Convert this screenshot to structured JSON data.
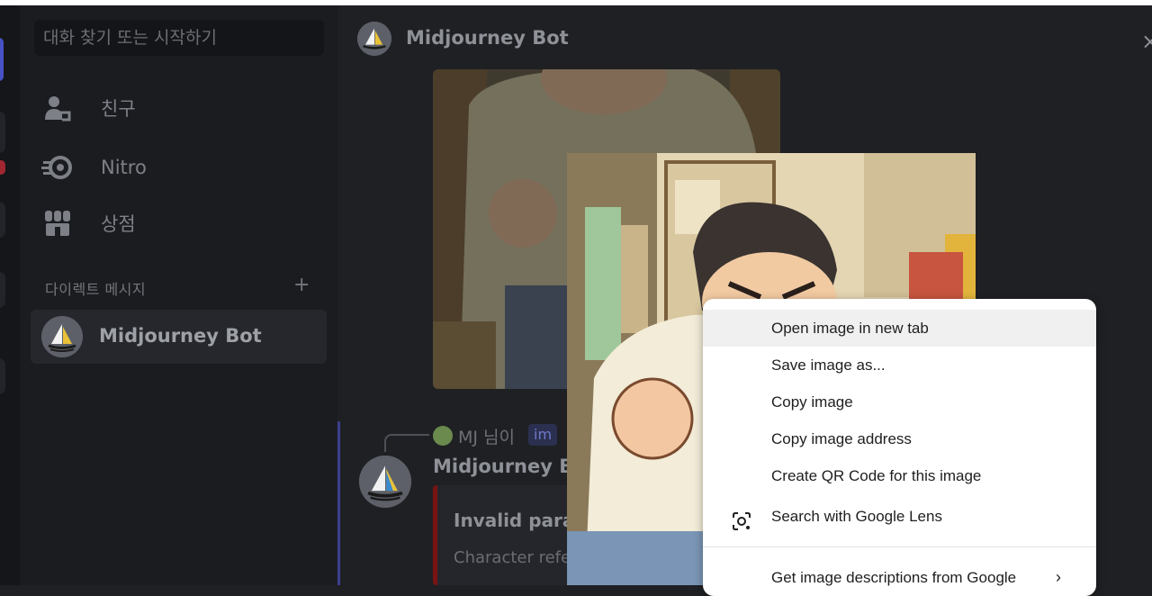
{
  "sidebar": {
    "search_placeholder": "대화 찾기 또는 시작하기",
    "nav": [
      {
        "label": "친구",
        "icon": "friends-icon"
      },
      {
        "label": "Nitro",
        "icon": "nitro-icon"
      },
      {
        "label": "상점",
        "icon": "shop-icon"
      }
    ],
    "dm_header": "다이렉트 메시지",
    "dm_add_symbol": "+",
    "dm_list": [
      {
        "name": "Midjourney Bot"
      }
    ]
  },
  "chat": {
    "header_name": "Midjourney Bot",
    "close_symbol": "×",
    "reply": {
      "user": "MJ 님이",
      "tag": "im"
    },
    "message": {
      "author": "Midjourney Bo",
      "embed_title": "Invalid param",
      "embed_desc": "Character refe"
    }
  },
  "context_menu": {
    "items": [
      {
        "label": "Open image in new tab",
        "highlighted": true
      },
      {
        "label": "Save image as..."
      },
      {
        "label": "Copy image"
      },
      {
        "label": "Copy image address"
      },
      {
        "label": "Create QR Code for this image"
      },
      {
        "label": "Search with Google Lens",
        "icon": "google-lens-icon"
      },
      {
        "label": "Get image descriptions from Google",
        "submenu_arrow": "›"
      }
    ]
  },
  "colors": {
    "accent": "#4752c4",
    "background": "#1f2023",
    "menu_bg": "#ffffff",
    "embed_bar": "#7a1414"
  }
}
